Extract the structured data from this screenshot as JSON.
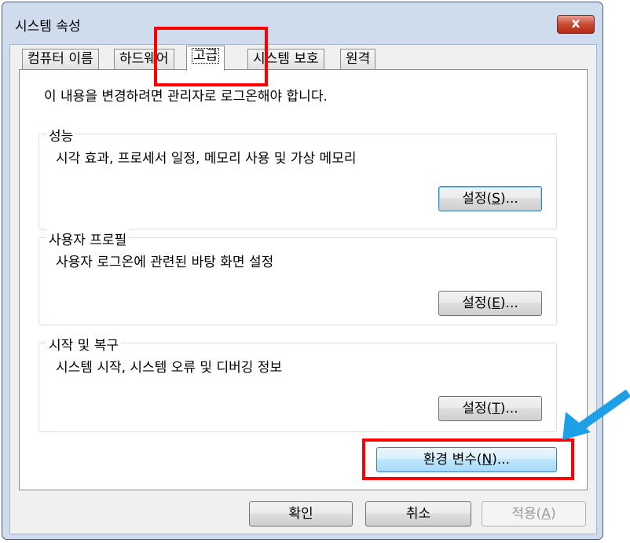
{
  "window": {
    "title": "시스템 속성",
    "close_glyph": "x"
  },
  "tabs": [
    {
      "label": "컴퓨터 이름",
      "active": false
    },
    {
      "label": "하드웨어",
      "active": false
    },
    {
      "label": "고급",
      "active": true
    },
    {
      "label": "시스템 보호",
      "active": false
    },
    {
      "label": "원격",
      "active": false
    }
  ],
  "advanced": {
    "admin_note": "이 내용을 변경하려면 관리자로 로그온해야 합니다.",
    "performance": {
      "title": "성능",
      "description": "시각 효과, 프로세서 일정, 메모리 사용 및 가상 메모리",
      "button": {
        "prefix": "설정(",
        "key": "S",
        "suffix": ")..."
      }
    },
    "user_profiles": {
      "title": "사용자 프로필",
      "description": "사용자 로그온에 관련된 바탕 화면 설정",
      "button": {
        "prefix": "설정(",
        "key": "E",
        "suffix": ")..."
      }
    },
    "startup_recovery": {
      "title": "시작 및 복구",
      "description": "시스템 시작, 시스템 오류 및 디버깅 정보",
      "button": {
        "prefix": "설정(",
        "key": "T",
        "suffix": ")..."
      }
    },
    "env_button": {
      "prefix": "환경 변수(",
      "key": "N",
      "suffix": ")..."
    }
  },
  "footer": {
    "ok": "확인",
    "cancel": "취소",
    "apply": {
      "prefix": "적용(",
      "key": "A",
      "suffix": ")"
    }
  },
  "annotation": {
    "highlight_color": "#ff0000",
    "arrow_color": "#1ea0e6"
  }
}
